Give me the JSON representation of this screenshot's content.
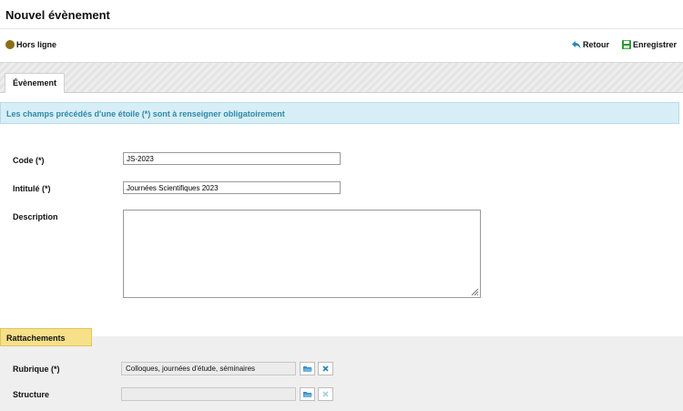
{
  "window": {
    "title": "Nouvel évènement"
  },
  "toolbar": {
    "status_label": "Hors ligne",
    "back_label": "Retour",
    "save_label": "Enregistrer"
  },
  "tabs": [
    {
      "label": "Évènement"
    }
  ],
  "info_message": "Les champs précédés d'une étoile (*) sont à renseigner obligatoirement",
  "form": {
    "code": {
      "label": "Code (*)",
      "value": "JS-2023"
    },
    "intitule": {
      "label": "Intitulé (*)",
      "value": "Journées Scientifiques 2023"
    },
    "description": {
      "label": "Description",
      "value": ""
    }
  },
  "rattachements": {
    "title": "Rattachements",
    "rubrique": {
      "label": "Rubrique (*)",
      "value": "Colloques, journées d'étude, séminaires"
    },
    "structure": {
      "label": "Structure",
      "value": ""
    }
  },
  "colors": {
    "status_dot": "#8b6f14",
    "info_bg": "#d7eef7",
    "info_text": "#2e8aa8",
    "section_tab": "#f7e08a",
    "back_icon": "#2a87b6",
    "save_icon": "#2e9a3a"
  },
  "icons": {
    "back": "arrow-back-icon",
    "save": "floppy-disk-icon",
    "browse": "folder-open-icon",
    "clear": "close-icon"
  }
}
